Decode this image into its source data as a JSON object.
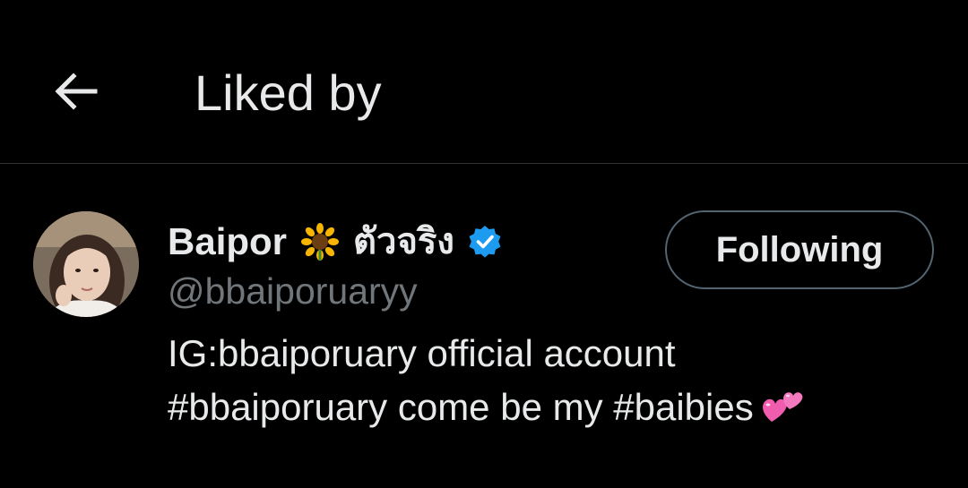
{
  "header": {
    "title": "Liked by",
    "back_icon": "arrow-left-icon"
  },
  "user": {
    "display_name": "Baipor",
    "name_emoji": "sunflower-icon",
    "thai_name": "ตัวจริง",
    "verified_icon": "verified-badge-icon",
    "handle": "@bbaiporuaryy",
    "bio_line_1": "IG:bbaiporuary official account",
    "bio_line_2": "#bbaiporuary come be my #baibies",
    "bio_emoji": "two-hearts-icon",
    "follow_button_label": "Following"
  },
  "colors": {
    "background": "#000000",
    "primary_text": "#e7e9ea",
    "secondary_text": "#71767b",
    "divider": "#2f3336",
    "verified_blue": "#1d9bf0",
    "hearts_pink": "#f05cae"
  }
}
